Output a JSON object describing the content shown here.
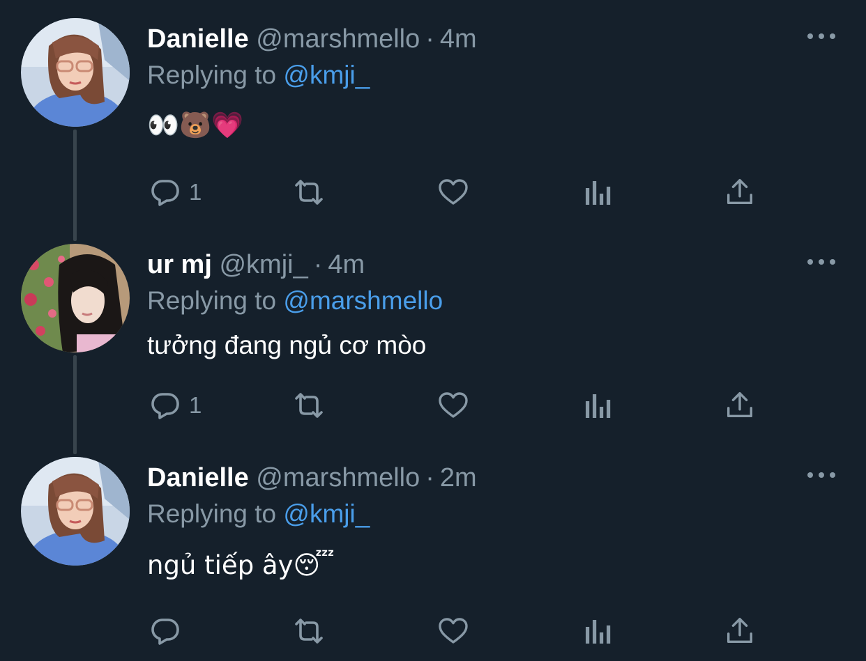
{
  "tweets": [
    {
      "name": "Danielle",
      "handle": "@marshmello",
      "separator": "·",
      "time": "4m",
      "replying_prefix": "Replying to",
      "replying_to": "@kmji_",
      "text": "👀🐻💗",
      "actions": {
        "reply_count": "1",
        "retweet_count": "",
        "like_count": ""
      },
      "avatar": "avatar-danielle"
    },
    {
      "name": "ur mj",
      "handle": "@kmji_",
      "separator": "·",
      "time": "4m",
      "replying_prefix": "Replying to",
      "replying_to": "@marshmello",
      "text": "tưởng đang ngủ cơ mòo",
      "actions": {
        "reply_count": "1",
        "retweet_count": "",
        "like_count": ""
      },
      "avatar": "avatar-urmj"
    },
    {
      "name": "Danielle",
      "handle": "@marshmello",
      "separator": "·",
      "time": "2m",
      "replying_prefix": "Replying to",
      "replying_to": "@kmji_",
      "text": "ngủ tiếp ây😴",
      "actions": {
        "reply_count": "",
        "retweet_count": "",
        "like_count": ""
      },
      "avatar": "avatar-danielle"
    }
  ],
  "icons": {
    "reply": "reply-icon",
    "retweet": "retweet-icon",
    "like": "like-icon",
    "analytics": "analytics-icon",
    "share": "share-icon",
    "more": "more-icon"
  },
  "colors": {
    "background": "#15202b",
    "text": "#ffffff",
    "secondary": "#8899a6",
    "link": "#4a9eea",
    "thread_line": "#38444d"
  }
}
